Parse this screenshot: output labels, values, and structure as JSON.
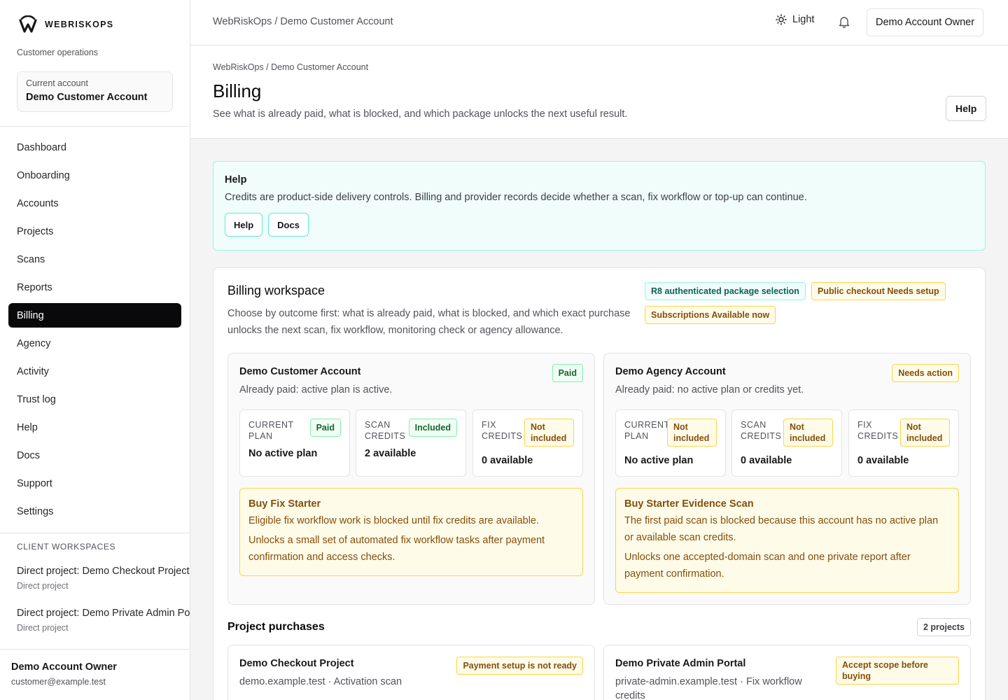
{
  "brand": {
    "name": "WEBRISKOPS",
    "tagline": "Customer operations"
  },
  "current_account": {
    "label": "Current account",
    "value": "Demo Customer Account"
  },
  "nav": [
    {
      "label": "Dashboard"
    },
    {
      "label": "Onboarding"
    },
    {
      "label": "Accounts"
    },
    {
      "label": "Projects"
    },
    {
      "label": "Scans"
    },
    {
      "label": "Reports"
    },
    {
      "label": "Billing",
      "active": true
    },
    {
      "label": "Agency"
    },
    {
      "label": "Activity"
    },
    {
      "label": "Trust log"
    },
    {
      "label": "Help"
    },
    {
      "label": "Docs"
    },
    {
      "label": "Support"
    },
    {
      "label": "Settings"
    }
  ],
  "client_workspaces": {
    "title": "CLIENT WORKSPACES",
    "items": [
      {
        "title": "Direct project: Demo Checkout Project",
        "sub": "Direct project"
      },
      {
        "title": "Direct project: Demo Private Admin Portal",
        "sub": "Direct project"
      }
    ]
  },
  "owner": {
    "name": "Demo Account Owner",
    "email": "customer@example.test"
  },
  "topbar": {
    "breadcrumb": "WebRiskOps / Demo Customer Account",
    "theme_label": "Light",
    "owner_button": "Demo Account Owner"
  },
  "page": {
    "breadcrumb": "WebRiskOps / Demo Customer Account",
    "title": "Billing",
    "subtitle": "See what is already paid, what is blocked, and which package unlocks the next useful result.",
    "help_button": "Help"
  },
  "help_callout": {
    "title": "Help",
    "text": "Credits are product-side delivery controls. Billing and provider records decide whether a scan, fix workflow or top-up can continue.",
    "buttons": [
      "Help",
      "Docs"
    ]
  },
  "workspace": {
    "title": "Billing workspace",
    "description": "Choose by outcome first: what is already paid, what is blocked, and which exact purchase unlocks the next scan, fix workflow, monitoring check or agency allowance.",
    "badges": [
      {
        "text": "R8 authenticated package selection",
        "style": "teal"
      },
      {
        "text": "Public checkout Needs setup",
        "style": "amber"
      },
      {
        "text": "Subscriptions Available now",
        "style": "amber"
      }
    ]
  },
  "accounts": [
    {
      "name": "Demo Customer Account",
      "status": "Paid",
      "paid_text": "Already paid: active plan is active.",
      "metrics": [
        {
          "label": "CURRENT PLAN",
          "badge": "Paid",
          "value": "No active plan"
        },
        {
          "label": "SCAN CREDITS",
          "badge": "Included",
          "value": "2 available"
        },
        {
          "label": "FIX CREDITS",
          "badge": "Not included",
          "value": "0 available"
        }
      ],
      "buy": {
        "title": "Buy Fix Starter",
        "lines": [
          "Eligible fix workflow work is blocked until fix credits are available.",
          "Unlocks a small set of automated fix workflow tasks after payment confirmation and access checks."
        ]
      }
    },
    {
      "name": "Demo Agency Account",
      "status": "Needs action",
      "paid_text": "Already paid: no active plan or credits yet.",
      "metrics": [
        {
          "label": "CURRENT PLAN",
          "badge": "Not included",
          "value": "No active plan"
        },
        {
          "label": "SCAN CREDITS",
          "badge": "Not included",
          "value": "0 available"
        },
        {
          "label": "FIX CREDITS",
          "badge": "Not included",
          "value": "0 available"
        }
      ],
      "buy": {
        "title": "Buy Starter Evidence Scan",
        "lines": [
          "The first paid scan is blocked because this account has no active plan or available scan credits.",
          "Unlocks one accepted-domain scan and one private report after payment confirmation."
        ]
      }
    }
  ],
  "project_purchases": {
    "title": "Project purchases",
    "count": "2 projects",
    "items": [
      {
        "name": "Demo Checkout Project",
        "sub": "demo.example.test · Activation scan",
        "badge": "Payment setup is not ready"
      },
      {
        "name": "Demo Private Admin Portal",
        "sub": "private-admin.example.test · Fix workflow credits",
        "badge": "Accept scope before buying"
      }
    ]
  }
}
